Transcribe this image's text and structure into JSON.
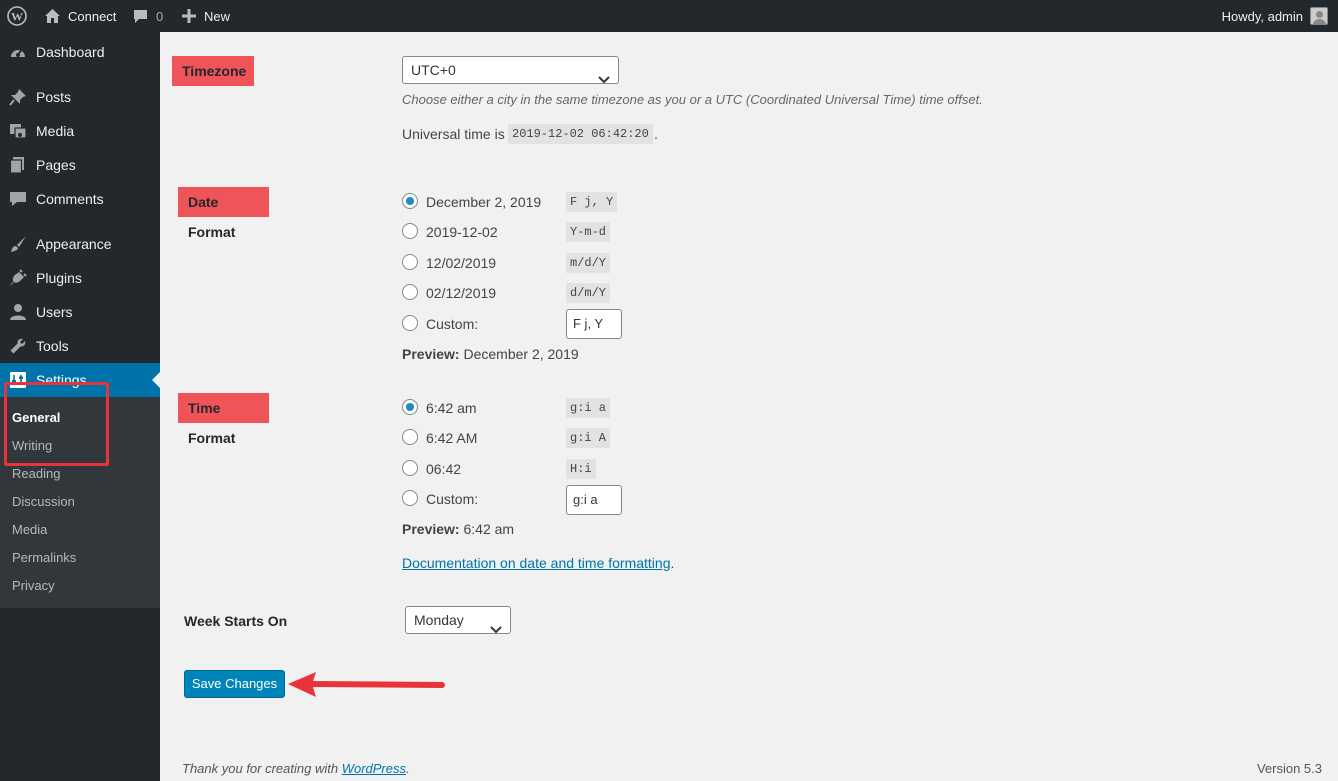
{
  "adminbar": {
    "site_name": "Connect",
    "comments_count": "0",
    "new_label": "New",
    "howdy": "Howdy, admin"
  },
  "sidebar": {
    "items": [
      {
        "label": "Dashboard",
        "icon": "dashboard-icon"
      },
      {
        "label": "Posts",
        "icon": "pin-icon"
      },
      {
        "label": "Media",
        "icon": "media-icon"
      },
      {
        "label": "Pages",
        "icon": "pages-icon"
      },
      {
        "label": "Comments",
        "icon": "comment-icon"
      },
      {
        "label": "Appearance",
        "icon": "brush-icon"
      },
      {
        "label": "Plugins",
        "icon": "plug-icon"
      },
      {
        "label": "Users",
        "icon": "user-icon"
      },
      {
        "label": "Tools",
        "icon": "wrench-icon"
      },
      {
        "label": "Settings",
        "icon": "settings-icon"
      }
    ],
    "submenu": [
      "General",
      "Writing",
      "Reading",
      "Discussion",
      "Media",
      "Permalinks",
      "Privacy"
    ]
  },
  "timezone": {
    "label": "Timezone",
    "selected": "UTC+0",
    "description": "Choose either a city in the same timezone as you or a UTC (Coordinated Universal Time) time offset.",
    "universal_prefix": "Universal time is",
    "universal_value": "2019-12-02 06:42:20",
    "universal_suffix": "."
  },
  "date_format": {
    "label": "Date Format",
    "options": [
      {
        "label": "December 2, 2019",
        "code": "F j, Y",
        "checked": true
      },
      {
        "label": "2019-12-02",
        "code": "Y-m-d",
        "checked": false
      },
      {
        "label": "12/02/2019",
        "code": "m/d/Y",
        "checked": false
      },
      {
        "label": "02/12/2019",
        "code": "d/m/Y",
        "checked": false
      }
    ],
    "custom_label": "Custom:",
    "custom_value": "F j, Y",
    "preview_label": "Preview:",
    "preview_value": "December 2, 2019"
  },
  "time_format": {
    "label": "Time Format",
    "options": [
      {
        "label": "6:42 am",
        "code": "g:i a",
        "checked": true
      },
      {
        "label": "6:42 AM",
        "code": "g:i A",
        "checked": false
      },
      {
        "label": "06:42",
        "code": "H:i",
        "checked": false
      }
    ],
    "custom_label": "Custom:",
    "custom_value": "g:i a",
    "preview_label": "Preview:",
    "preview_value": "6:42 am",
    "doc_link": "Documentation on date and time formatting",
    "doc_suffix": "."
  },
  "week": {
    "label": "Week Starts On",
    "selected": "Monday"
  },
  "save_label": "Save Changes",
  "footer": {
    "thanks_prefix": "Thank you for creating with ",
    "wp_link": "WordPress",
    "thanks_suffix": ".",
    "version": "Version 5.3"
  },
  "colors": {
    "adminbar_bg": "#23282d",
    "accent": "#0073aa",
    "highlight_label": "#ef5459",
    "annotation_red": "#e8333a"
  }
}
